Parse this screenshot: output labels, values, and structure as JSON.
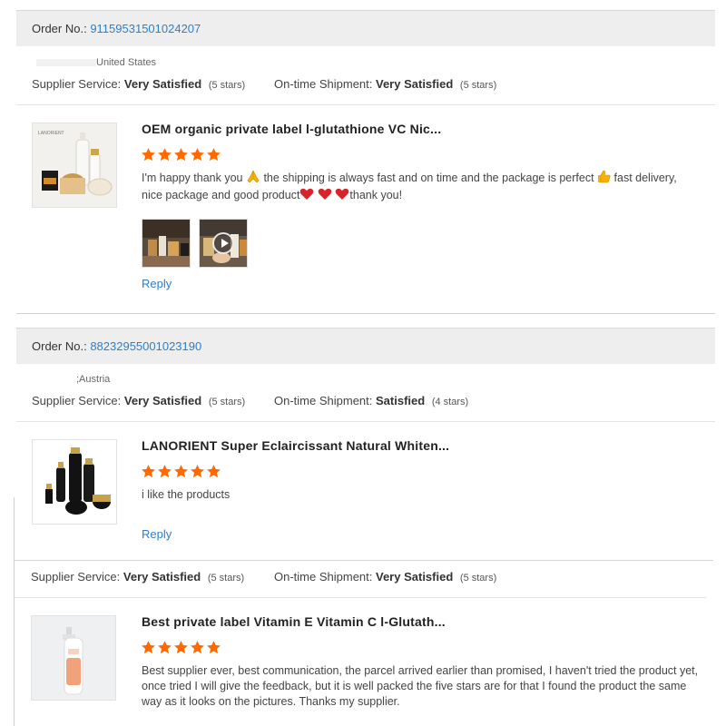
{
  "orders": [
    {
      "order_label": "Order No.:",
      "order_number": "91159531501024207",
      "country": "United States",
      "supplier_service_label": "Supplier Service:",
      "supplier_service_value": "Very Satisfied",
      "supplier_service_stars": "(5 stars)",
      "shipment_label": "On-time Shipment:",
      "shipment_value": "Very Satisfied",
      "shipment_stars": "(5 stars)",
      "product_title": "OEM organic private label l-glutathione VC Nic...",
      "rating": 5,
      "comment_part1": "I'm happy thank you",
      "comment_part2": "the shipping is always fast and on time and the package is perfect",
      "comment_part3": "fast delivery,",
      "comment_part4": "nice package and good product",
      "comment_part5": "thank you!",
      "reply_label": "Reply"
    },
    {
      "order_label": "Order No.:",
      "order_number": "88232955001023190",
      "country": ";Austria",
      "supplier_service_label": "Supplier Service:",
      "supplier_service_value": "Very Satisfied",
      "supplier_service_stars": "(5 stars)",
      "shipment_label": "On-time Shipment:",
      "shipment_value": "Satisfied",
      "shipment_stars": "(4 stars)",
      "product_title": "LANORIENT Super Eclaircissant Natural Whiten...",
      "rating": 5,
      "comment": "i like the products",
      "reply_label": "Reply"
    },
    {
      "supplier_service_label": "Supplier Service:",
      "supplier_service_value": "Very Satisfied",
      "supplier_service_stars": "(5 stars)",
      "shipment_label": "On-time Shipment:",
      "shipment_value": "Very Satisfied",
      "shipment_stars": "(5 stars)",
      "product_title": "Best private label Vitamin E Vitamin C l-Glutath...",
      "rating": 5,
      "comment": "Best supplier ever, best communication, the parcel arrived earlier than promised, I haven't tried the product yet, once tried I will give the feedback, but it is well packed the five stars are for that I found the product the same way as it looks on the pictures. Thanks my supplier."
    }
  ],
  "thumbnail_brand": "LANORIENT",
  "colors": {
    "link": "#2e7fc8",
    "star": "#ff6a00",
    "order_bar_bg": "#eeeeee",
    "heart": "#d8232a",
    "thumbs": "#f5b400"
  },
  "icons": {
    "star": "star-icon",
    "play": "play-icon",
    "pray": "praying-hands-icon",
    "thumbs": "thumbs-up-icon",
    "heart": "heart-icon"
  }
}
